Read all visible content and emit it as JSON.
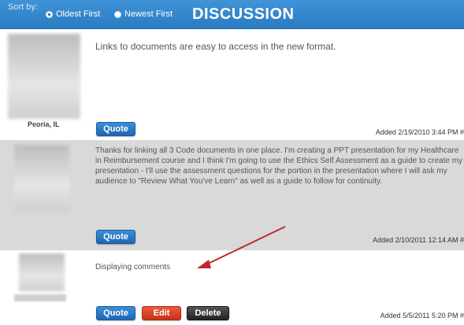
{
  "header": {
    "sort_label": "Sort by:",
    "options": [
      {
        "label": "Oldest First",
        "selected": true
      },
      {
        "label": "Newest First",
        "selected": false
      }
    ],
    "title": "DISCUSSION"
  },
  "comments": [
    {
      "location": "Peoria, IL",
      "text": "Links to documents are easy to access in the new format.",
      "quote_label": "Quote",
      "added": "Added 2/19/2010 3:44 PM #"
    },
    {
      "location": "",
      "text": "Thanks for linking all 3 Code documents in one place.  I'm creating a PPT presentation for my Healthcare in Reimbursement course and I think I'm going to use the Ethics Self Assessment as a guide to create my presentation  - I'll use the assessment questions for the portion in the presentation where I will ask my audience to  \"Review What You've Learn\"  as well as a guide to follow for continuity.",
      "quote_label": "Quote",
      "added": "Added 2/10/2011 12:14 AM #"
    },
    {
      "location": "",
      "text": "Displaying comments",
      "quote_label": "Quote",
      "edit_label": "Edit",
      "delete_label": "Delete",
      "added": "Added 5/5/2011 5:20 PM #"
    }
  ],
  "colors": {
    "header": "#2a7cc2",
    "highlight_row": "#d9d9d9",
    "arrow": "#c0272d"
  }
}
